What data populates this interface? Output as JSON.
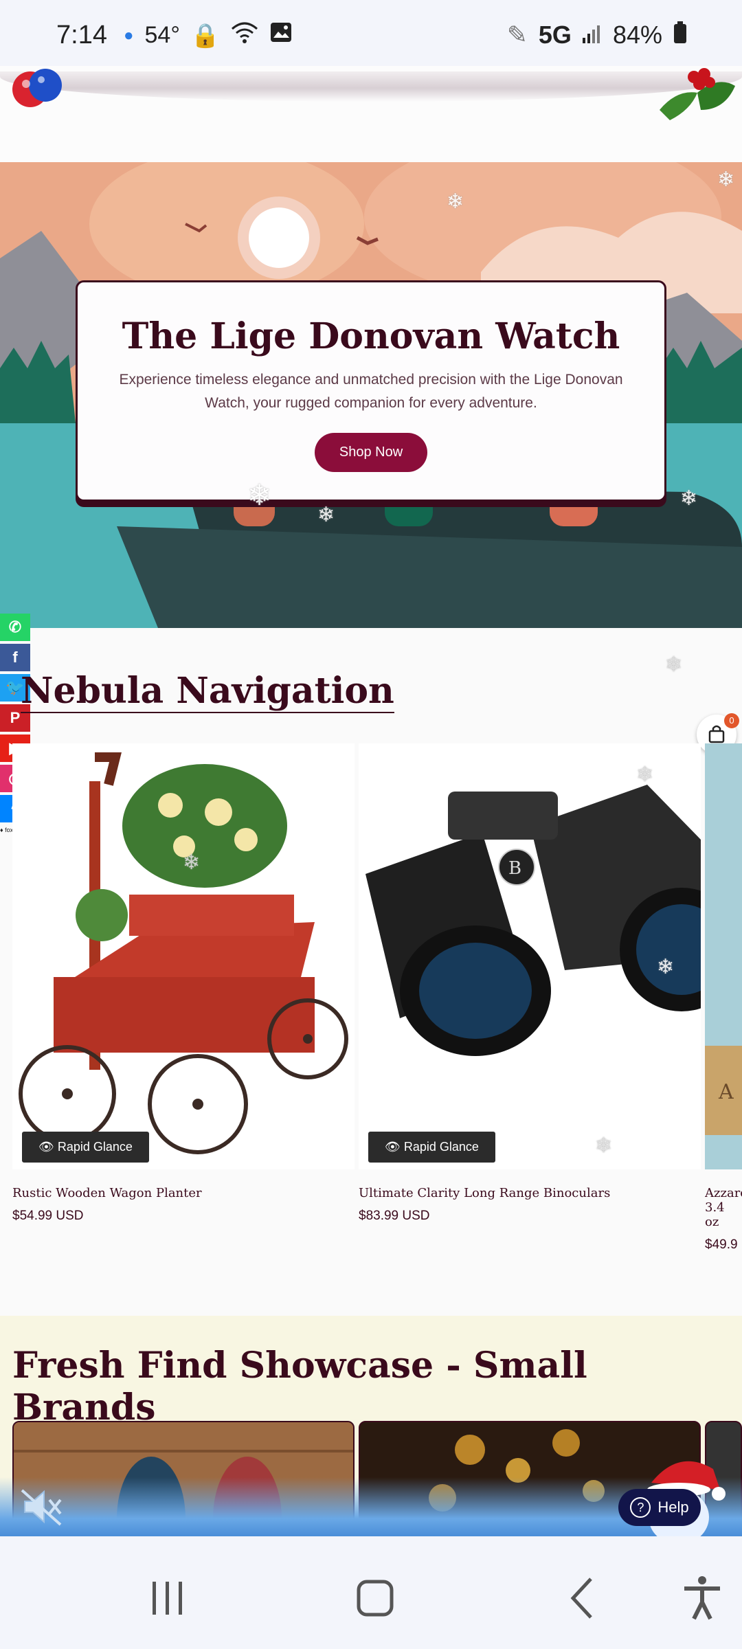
{
  "status_bar": {
    "time": "7:14",
    "temperature": "54°",
    "network": "5G",
    "battery": "84%"
  },
  "hero": {
    "title": "The Lige Donovan Watch",
    "description": "Experience timeless elegance and unmatched precision with the Lige Donovan Watch, your rugged companion for every adventure.",
    "button_label": "Shop Now"
  },
  "social": [
    {
      "icon": "whatsapp-icon",
      "glyph": "✆",
      "color": "#25d366"
    },
    {
      "icon": "facebook-icon",
      "glyph": "f",
      "color": "#3b5998"
    },
    {
      "icon": "twitter-icon",
      "glyph": "🐦",
      "color": "#1da1f2"
    },
    {
      "icon": "pinterest-icon",
      "glyph": "P",
      "color": "#cb2027"
    },
    {
      "icon": "youtube-icon",
      "glyph": "▶",
      "color": "#e62117"
    },
    {
      "icon": "instagram-icon",
      "glyph": "◎",
      "color": "#e1306c"
    },
    {
      "icon": "messenger-icon",
      "glyph": "ϟ",
      "color": "#0084ff"
    }
  ],
  "social_caption": "♦ foxprime",
  "nebula": {
    "title": "Nebula Navigation",
    "cart_count": "0",
    "products": [
      {
        "name": "Rustic Wooden Wagon Planter",
        "price": "$54.99 USD",
        "glance_label": "Rapid Glance"
      },
      {
        "name": "Ultimate Clarity Long Range Binoculars",
        "price": "$83.99 USD",
        "glance_label": "Rapid Glance"
      },
      {
        "name": "Azzaro",
        "name_line2": "3.4 oz",
        "price": "$49.9"
      }
    ]
  },
  "showcase": {
    "title": "Fresh Find Showcase - Small Brands"
  },
  "help": {
    "label": "Help"
  },
  "colors": {
    "brand": "#3a0a1c",
    "button": "#8b0d3a",
    "showcase_bg": "#f8f6e2"
  }
}
